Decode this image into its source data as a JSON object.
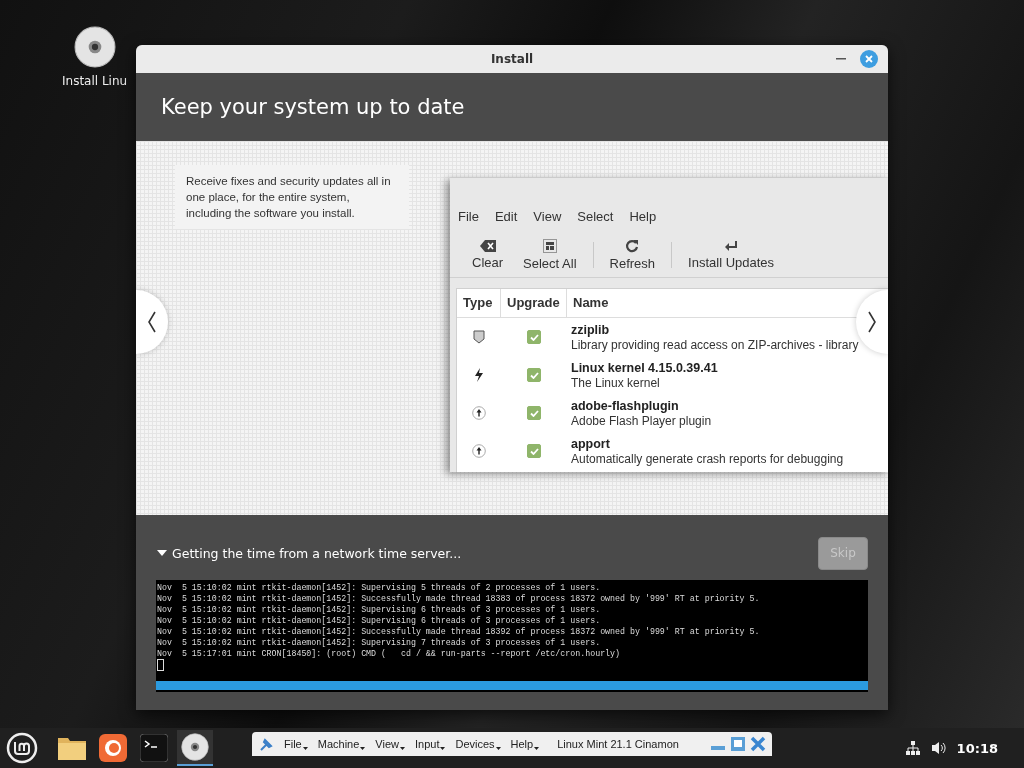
{
  "desktop_icons": [
    {
      "label": "Install Linu"
    }
  ],
  "window": {
    "title": "Install",
    "slide": {
      "heading": "Keep your system up to date",
      "description": "Receive fixes and security updates all in one place, for the entire system, including the software you install.",
      "screenshot": {
        "menu": [
          "File",
          "Edit",
          "View",
          "Select",
          "Help"
        ],
        "toolbar": [
          {
            "kind": "clear",
            "label": "Clear"
          },
          {
            "kind": "select-all",
            "label": "Select All"
          },
          {
            "kind": "refresh",
            "label": "Refresh"
          },
          {
            "kind": "install",
            "label": "Install Updates"
          }
        ],
        "columns": [
          "Type",
          "Upgrade",
          "Name"
        ],
        "rows": [
          {
            "kind": "security",
            "checked": true,
            "name": "zziplib",
            "description": "Library providing read access on ZIP-archives - library"
          },
          {
            "kind": "kernel",
            "checked": true,
            "name": "Linux kernel 4.15.0.39.41",
            "description": "The Linux kernel"
          },
          {
            "kind": "package",
            "checked": true,
            "name": "adobe-flashplugin",
            "description": "Adobe Flash Player plugin"
          },
          {
            "kind": "package",
            "checked": true,
            "name": "apport",
            "description": "Automatically generate crash reports for debugging"
          }
        ]
      }
    },
    "progress": {
      "status": "Getting the time from a network time server...",
      "expanded": true,
      "skip": {
        "label": "Skip",
        "disabled": true
      },
      "log": [
        "Nov  5 15:10:02 mint rtkit-daemon[1452]: Supervising 5 threads of 2 processes of 1 users.",
        "Nov  5 15:10:02 mint rtkit-daemon[1452]: Successfully made thread 18383 of process 18372 owned by '999' RT at priority 5.",
        "Nov  5 15:10:02 mint rtkit-daemon[1452]: Supervising 6 threads of 3 processes of 1 users.",
        "Nov  5 15:10:02 mint rtkit-daemon[1452]: Supervising 6 threads of 3 processes of 1 users.",
        "Nov  5 15:10:02 mint rtkit-daemon[1452]: Successfully made thread 18392 of process 18372 owned by '999' RT at priority 5.",
        "Nov  5 15:10:02 mint rtkit-daemon[1452]: Supervising 7 threads of 3 processes of 1 users.",
        "Nov  5 15:17:01 mint CRON[18450]: (root) CMD (   cd / && run-parts --report /etc/cron.hourly)"
      ],
      "level": 1
    }
  },
  "taskbar": {
    "apps": [
      {
        "kind": "files",
        "active": false
      },
      {
        "kind": "browser",
        "active": false
      },
      {
        "kind": "terminal",
        "active": false
      },
      {
        "kind": "disc",
        "active": true
      }
    ],
    "clock": "10:18"
  },
  "vm_bar": {
    "menu": [
      "File",
      "Machine",
      "View",
      "Input",
      "Devices",
      "Help"
    ],
    "title": "Linux Mint 21.1 Cinamon"
  }
}
